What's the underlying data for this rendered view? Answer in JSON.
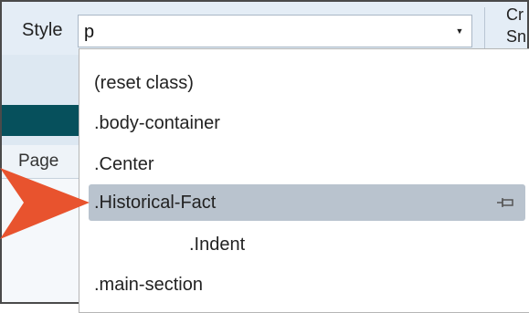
{
  "toolbar": {
    "style_label": "Style",
    "style_value": "p",
    "truncated_line1": "Cr",
    "truncated_line2": "Sn"
  },
  "left_pane": {
    "column_header": "Page"
  },
  "dropdown": {
    "items": [
      {
        "label": "(reset class)"
      },
      {
        "label": ".body-container"
      },
      {
        "label": ".Center"
      },
      {
        "label": ".Historical-Fact",
        "selected": true
      },
      {
        "label": ".Indent"
      },
      {
        "label": ".main-section"
      }
    ]
  },
  "colors": {
    "selection": "#b9c3ce",
    "arrow": "#e8532e",
    "teal_bar": "#06505c"
  },
  "icons": [
    "chevron-down-icon",
    "pin-icon",
    "red-arrow-icon"
  ]
}
